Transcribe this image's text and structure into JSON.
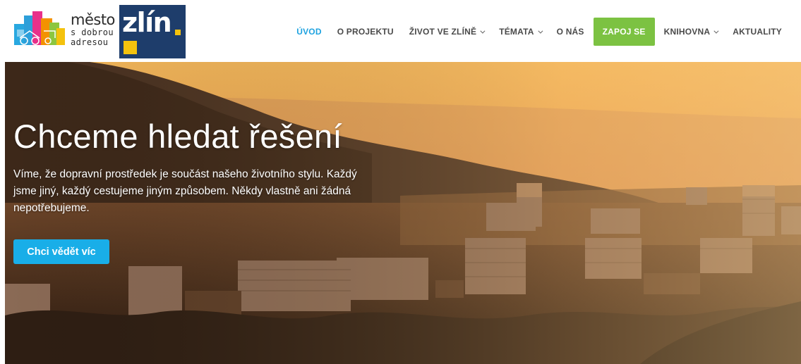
{
  "logo": {
    "line1": "město",
    "line2": "s dobrou",
    "line3": "adresou",
    "city": "zlín"
  },
  "nav": {
    "items": [
      {
        "label": "ÚVOD",
        "active": true,
        "dropdown": false
      },
      {
        "label": "O PROJEKTU",
        "active": false,
        "dropdown": false
      },
      {
        "label": "ŽIVOT VE ZLÍNĚ",
        "active": false,
        "dropdown": true
      },
      {
        "label": "TÉMATA",
        "active": false,
        "dropdown": true
      },
      {
        "label": "O NÁS",
        "active": false,
        "dropdown": false
      },
      {
        "label": "ZAPOJ SE",
        "active": false,
        "dropdown": false,
        "cta": true
      },
      {
        "label": "KNIHOVNA",
        "active": false,
        "dropdown": true
      },
      {
        "label": "AKTUALITY",
        "active": false,
        "dropdown": false
      }
    ]
  },
  "hero": {
    "title": "Chceme hledat řešení",
    "text": "Víme, že dopravní prostředek je součást našeho životního stylu. Každý jsme jiný, každý cestujeme jiným způsobem. Někdy vlastně ani žádná nepotřebujeme.",
    "button_label": "Chci vědět víc"
  },
  "colors": {
    "accent": "#1fa3e0",
    "cta_green": "#7cc242",
    "button_blue": "#19aee8",
    "brand_navy": "#1e3d6b",
    "brand_yellow": "#f4c20d"
  }
}
